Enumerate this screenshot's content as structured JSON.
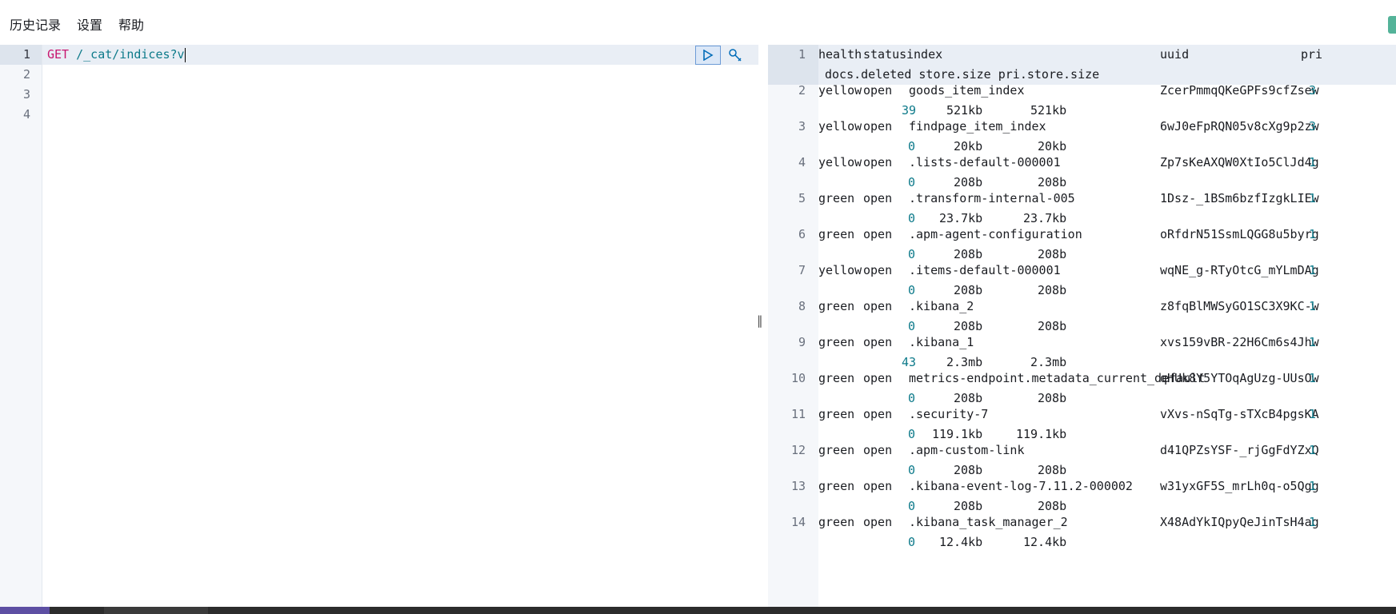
{
  "menu": {
    "history": "历史记录",
    "settings": "设置",
    "help": "帮助"
  },
  "editor": {
    "line_numbers": [
      "1",
      "2",
      "3",
      "4"
    ],
    "method": "GET",
    "path": "/_cat/indices?v"
  },
  "icons": {
    "run": "play-icon",
    "wrench": "wrench-icon",
    "divider": "drag-handle-icon"
  },
  "output": {
    "header": {
      "ln": "1",
      "line1": {
        "health": "health",
        "status": "status",
        "index": "index",
        "uuid": "uuid",
        "pri": "pri"
      },
      "line2": "docs.deleted store.size pri.store.size"
    },
    "rows": [
      {
        "ln": "2",
        "health": "yellow",
        "status": "open",
        "index": "goods_item_index",
        "uuid": "ZcerPmmqQKeGPFs9cfZsew",
        "pri": "3",
        "docs_deleted": "39",
        "store_size": "521kb",
        "pri_store_size": "521kb"
      },
      {
        "ln": "3",
        "health": "yellow",
        "status": "open",
        "index": "findpage_item_index",
        "uuid": "6wJ0eFpRQN05v8cXg9p2zw",
        "pri": "3",
        "docs_deleted": "0",
        "store_size": "20kb",
        "pri_store_size": "20kb"
      },
      {
        "ln": "4",
        "health": "yellow",
        "status": "open",
        "index": ".lists-default-000001",
        "uuid": "Zp7sKeAXQW0XtIo5ClJd4g",
        "pri": "1",
        "docs_deleted": "0",
        "store_size": "208b",
        "pri_store_size": "208b"
      },
      {
        "ln": "5",
        "health": "green",
        "status": "open",
        "index": ".transform-internal-005",
        "uuid": "1Dsz-_1BSm6bzfIzgkLIEw",
        "pri": "1",
        "docs_deleted": "0",
        "store_size": "23.7kb",
        "pri_store_size": "23.7kb"
      },
      {
        "ln": "6",
        "health": "green",
        "status": "open",
        "index": ".apm-agent-configuration",
        "uuid": "oRfdrN51SsmLQGG8u5byrg",
        "pri": "1",
        "docs_deleted": "0",
        "store_size": "208b",
        "pri_store_size": "208b"
      },
      {
        "ln": "7",
        "health": "yellow",
        "status": "open",
        "index": ".items-default-000001",
        "uuid": "wqNE_g-RTyOtcG_mYLmDAg",
        "pri": "1",
        "docs_deleted": "0",
        "store_size": "208b",
        "pri_store_size": "208b"
      },
      {
        "ln": "8",
        "health": "green",
        "status": "open",
        "index": ".kibana_2",
        "uuid": "z8fqBlMWSyGO1SC3X9KC-w",
        "pri": "1",
        "docs_deleted": "0",
        "store_size": "208b",
        "pri_store_size": "208b"
      },
      {
        "ln": "9",
        "health": "green",
        "status": "open",
        "index": ".kibana_1",
        "uuid": "xvs159vBR-22H6Cm6s4Jhw",
        "pri": "1",
        "docs_deleted": "43",
        "store_size": "2.3mb",
        "pri_store_size": "2.3mb"
      },
      {
        "ln": "10",
        "health": "green",
        "status": "open",
        "index": "metrics-endpoint.metadata_current_default",
        "uuid": "qHUk8Y5YTOqAgUzg-UUsOw",
        "pri": "1",
        "docs_deleted": "0",
        "store_size": "208b",
        "pri_store_size": "208b"
      },
      {
        "ln": "11",
        "health": "green",
        "status": "open",
        "index": ".security-7",
        "uuid": "vXvs-nSqTg-sTXcB4pgsKA",
        "pri": "1",
        "docs_deleted": "0",
        "store_size": "119.1kb",
        "pri_store_size": "119.1kb"
      },
      {
        "ln": "12",
        "health": "green",
        "status": "open",
        "index": ".apm-custom-link",
        "uuid": "d41QPZsYSF-_rjGgFdYZxQ",
        "pri": "1",
        "docs_deleted": "0",
        "store_size": "208b",
        "pri_store_size": "208b"
      },
      {
        "ln": "13",
        "health": "green",
        "status": "open",
        "index": ".kibana-event-log-7.11.2-000002",
        "uuid": "w31yxGF5S_mrLh0q-o5Qgg",
        "pri": "1",
        "docs_deleted": "0",
        "store_size": "208b",
        "pri_store_size": "208b"
      },
      {
        "ln": "14",
        "health": "green",
        "status": "open",
        "index": ".kibana_task_manager_2",
        "uuid": "X48AdYkIQpyQeJinTsH4ag",
        "pri": "1",
        "docs_deleted": "0",
        "store_size": "12.4kb",
        "pri_store_size": "12.4kb"
      }
    ]
  }
}
